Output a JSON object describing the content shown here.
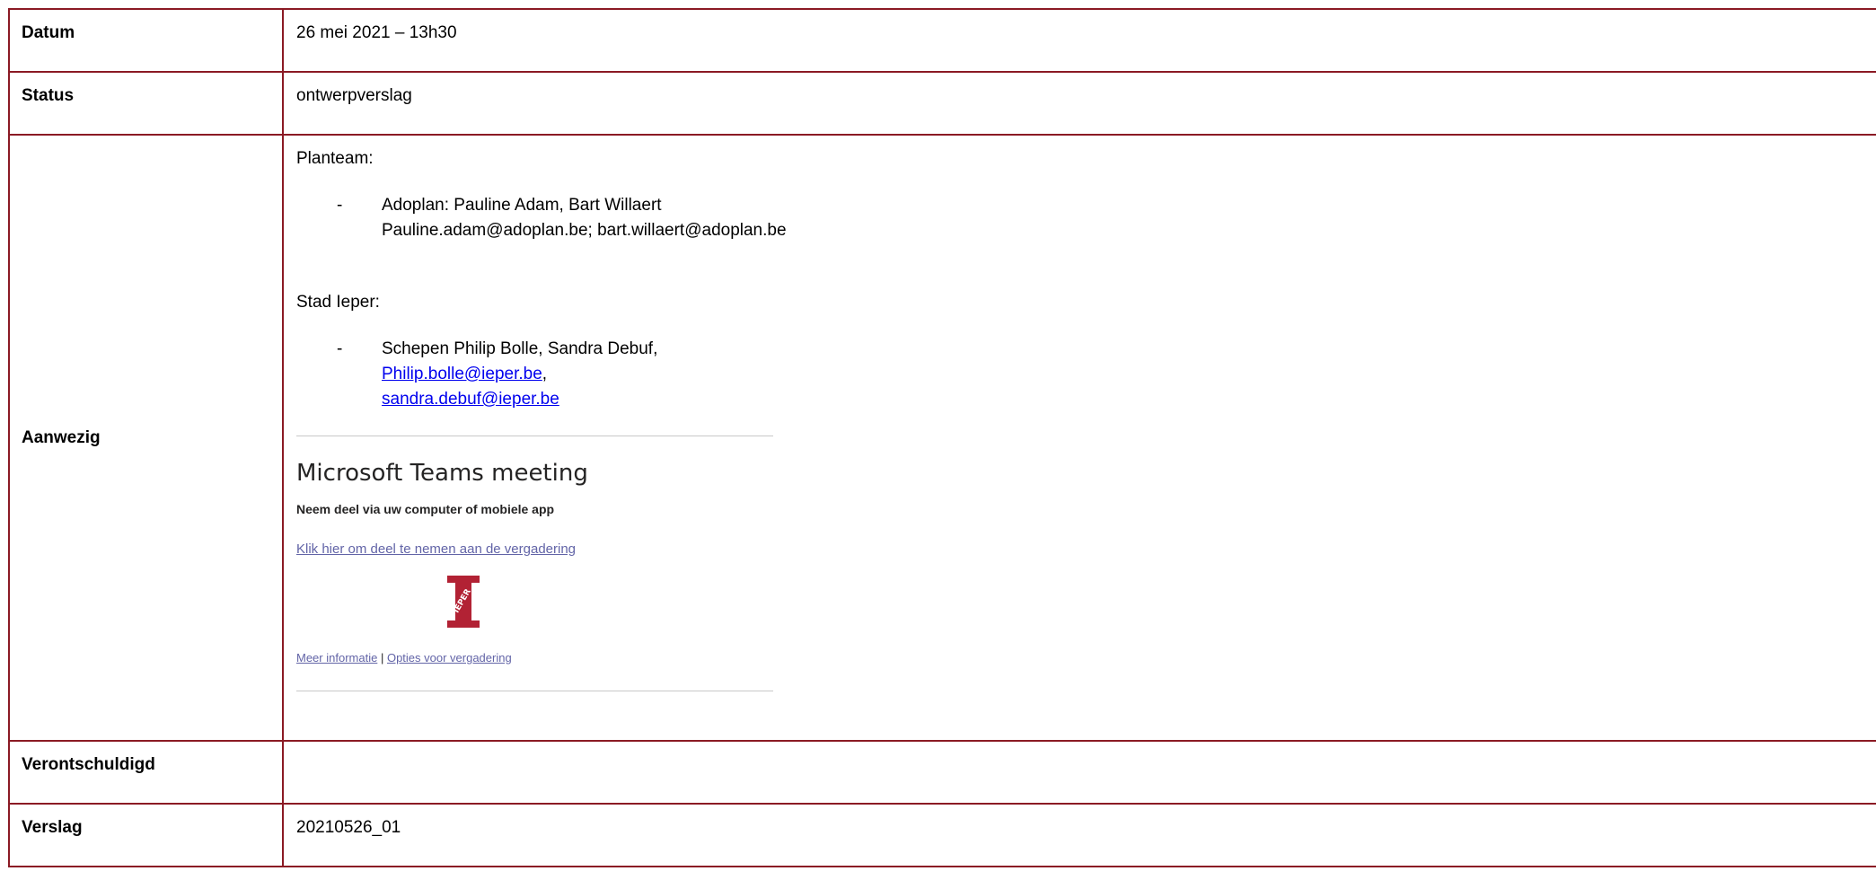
{
  "rows": {
    "datum": {
      "label": "Datum",
      "value": "26 mei 2021 – 13h30"
    },
    "status": {
      "label": "Status",
      "value": "ontwerpverslag"
    },
    "aanwezig": {
      "label": "Aanwezig",
      "planteam_heading": "Planteam:",
      "planteam_dash": "-",
      "planteam_names": "Adoplan: Pauline Adam, Bart Willaert",
      "planteam_emails": "Pauline.adam@adoplan.be; bart.willaert@adoplan.be",
      "stad_heading": "Stad Ieper:",
      "stad_dash": "-",
      "stad_names": "Schepen Philip Bolle, Sandra Debuf,",
      "stad_email_1": "Philip.bolle@ieper.be",
      "stad_email_sep": ",",
      "stad_email_2": "sandra.debuf@ieper.be",
      "teams": {
        "title": "Microsoft Teams meeting",
        "join_heading": "Neem deel via uw computer of mobiele app",
        "join_link": "Klik hier om deel te nemen aan de vergadering",
        "logo_text": "IEPER",
        "more_info": "Meer informatie",
        "separator": "|",
        "options": "Opties voor vergadering"
      }
    },
    "verontschuldigd": {
      "label": "Verontschuldigd",
      "value": ""
    },
    "verslag": {
      "label": "Verslag",
      "value": "20210526_01"
    }
  },
  "colors": {
    "border": "#8b1a24",
    "link": "#0000ee",
    "teams_link": "#6264a7",
    "logo": "#b22234"
  }
}
